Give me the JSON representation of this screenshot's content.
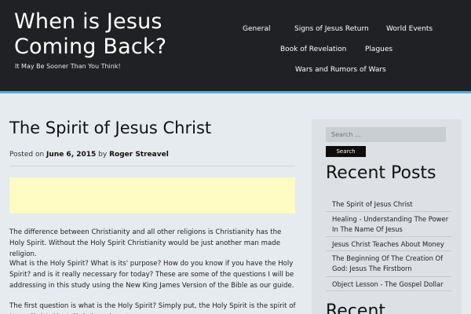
{
  "header": {
    "site_title": "When is Jesus Coming Back?",
    "tagline": "It May Be Sooner Than You Think!"
  },
  "nav": {
    "items": [
      "General",
      "Signs of Jesus Return",
      "World Events",
      "Book of Revelation",
      "Plagues",
      "Wars and Rumors of Wars"
    ]
  },
  "post": {
    "title": "The Spirit of Jesus Christ",
    "posted_on_label": "Posted on",
    "date": "June 6, 2015",
    "by_label": "by",
    "author": "Roger Streavel",
    "paragraphs": [
      "The difference between Christianity and all other religions is Christianity has the Holy Spirit. Without the Holy Spirit Christianity would be just another man made religion.",
      "What is the Holy Spirit? What is its' purpose? How do you know if you have the Holy Spirit? and is it really necessary for today? These are some of the questions I will be addressing in this study using the New King James Version of the Bible as our guide.",
      "The first question is what is the Holy Spirit? Simply put, the Holy Spirit is the spirit of Jesus Christ, Most Christians do not"
    ]
  },
  "sidebar": {
    "search_placeholder": "Search ...",
    "search_button": "Search",
    "recent_posts_title": "Recent Posts",
    "recent_posts": [
      "The Spirit of Jesus Christ",
      "Healing - Understanding The Power In The Name Of Jesus",
      "Jesus Christ Teaches About Money",
      "The Beginning Of The Creation Of God: Jesus The Firstborn",
      "Object Lesson - The Gospel Dollar"
    ],
    "next_widget_title": "Recent"
  },
  "colors": {
    "header_bg": "#202124",
    "accent_line": "#5aa6d6",
    "page_bg": "#e6ebf0",
    "ad_bg": "#fefbc3",
    "sidebar_bg": "#dde1e6"
  }
}
